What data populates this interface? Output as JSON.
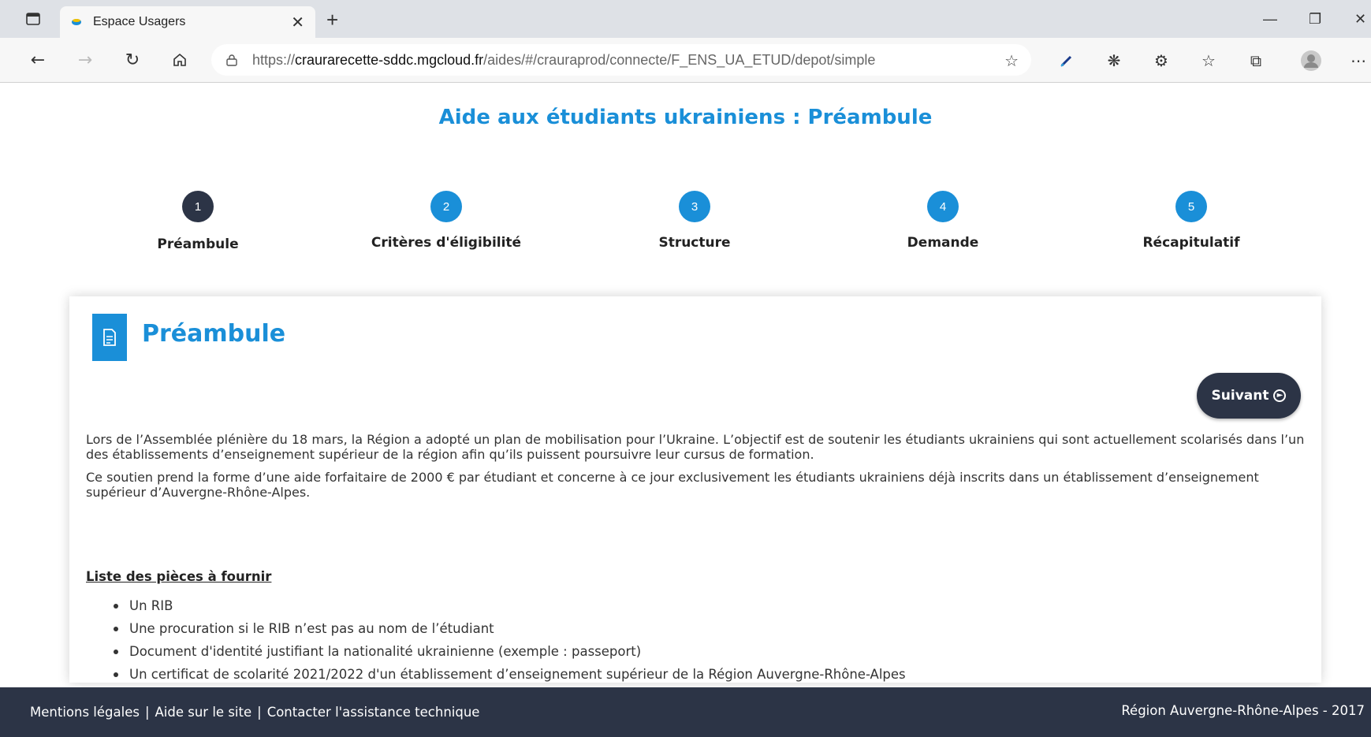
{
  "browser": {
    "tab_title": "Espace Usagers",
    "url_host": "craurarecette-sddc.mgcloud.fr",
    "url_prefix": "https://",
    "url_path": "/aides/#/crauraprod/connecte/F_ENS_UA_ETUD/depot/simple"
  },
  "page": {
    "title": "Aide aux étudiants ukrainiens : Préambule"
  },
  "steps": [
    {
      "number": "1",
      "label": "Préambule"
    },
    {
      "number": "2",
      "label": "Critères d'éligibilité"
    },
    {
      "number": "3",
      "label": "Structure"
    },
    {
      "number": "4",
      "label": "Demande"
    },
    {
      "number": "5",
      "label": "Récapitulatif"
    }
  ],
  "card": {
    "title": "Préambule",
    "next_label": "Suivant",
    "paragraph1": "Lors de l’Assemblée plénière du 18 mars, la Région a adopté un plan de mobilisation pour l’Ukraine. L’objectif est de soutenir les étudiants ukrainiens qui sont actuellement scolarisés dans l’un des établissements d’enseignement supérieur de la région afin qu’ils puissent poursuivre leur cursus de formation.",
    "paragraph2": "Ce soutien prend la forme d’une aide forfaitaire de 2000 € par étudiant et concerne à ce jour exclusivement les étudiants ukrainiens déjà inscrits dans un établissement d’enseignement supérieur d’Auvergne-Rhône-Alpes.",
    "list_heading": "Liste des pièces à fournir",
    "documents": [
      "Un RIB",
      "Une procuration si le RIB n’est pas au nom de l’étudiant",
      "Document d'identité justifiant la nationalité ukrainienne (exemple : passeport)",
      "Un certificat de scolarité 2021/2022 d'un établissement d’enseignement supérieur de la Région Auvergne-Rhône-Alpes"
    ]
  },
  "footer": {
    "legal": "Mentions légales",
    "help": "Aide sur le site",
    "contact": "Contacter l'assistance technique",
    "separator": "|",
    "copyright": "Région Auvergne-Rhône-Alpes - 2017"
  },
  "colors": {
    "accent": "#1a8fd8",
    "dark": "#2c3446"
  }
}
